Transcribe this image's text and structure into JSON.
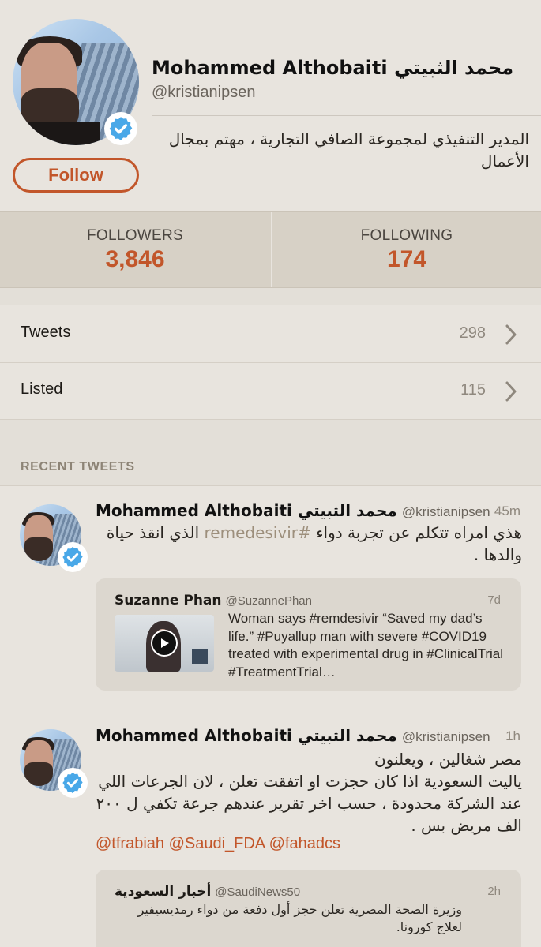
{
  "profile": {
    "name": "Mohammed Althobaiti محمد الثبيتي",
    "handle": "@kristianipsen",
    "bio": "المدير التنفيذي لمجموعة الصافي التجارية ، مهتم بمجال الأعمال",
    "follow_label": "Follow",
    "verified_icon": "verified-badge-icon"
  },
  "stats": {
    "followers_label": "FOLLOWERS",
    "followers_value": "3,846",
    "following_label": "FOLLOWING",
    "following_value": "174"
  },
  "rows": [
    {
      "label": "Tweets",
      "count": "298",
      "icon": "chevron-right-icon"
    },
    {
      "label": "Listed",
      "count": "115",
      "icon": "chevron-right-icon"
    }
  ],
  "recent_tweets_title": "RECENT TWEETS",
  "tweets": [
    {
      "name": "Mohammed Althobaiti محمد الثبيتي",
      "handle": "@kristianipsen",
      "time": "45m",
      "text_before": "هذي امراه تتكلم عن تجربة دواء ",
      "hashtag": "#remedesivir",
      "text_after": " الذي انقذ حياة والدها .",
      "quote": {
        "name": "Suzanne Phan",
        "handle": "@SuzannePhan",
        "time": "7d",
        "text": "Woman says #remdesivir “Saved my dad’s life.” #Puyallup man with severe #COVID19 treated with experimental drug in #ClinicalTrial #TreatmentTrial…",
        "media_icon": "play-icon"
      }
    },
    {
      "name": "Mohammed Althobaiti محمد الثبيتي",
      "handle": "@kristianipsen",
      "time": "1h",
      "text": "مصر شغالين ، ويعلنون\nياليت السعودية اذا كان حجزت او اتفقت تعلن ، لان الجرعات اللي عند الشركة محدودة ، حسب اخر تقرير عندهم جرعة تكفي ل ٢٠٠ الف مريض بس .",
      "mentions": "@tfrabiah @Saudi_FDA @fahadcs",
      "quote": {
        "name": "أخبار السعودية",
        "handle": "@SaudiNews50",
        "time": "2h",
        "text": "وزيرة الصحة المصرية تعلن حجز أول دفعة من دواء رمديسيفير لعلاج كورونا."
      }
    }
  ],
  "colors": {
    "accent": "#c2562a",
    "background": "#e8e4de",
    "stats_background": "#d7d1c6",
    "verified_blue": "#49a8e8"
  }
}
